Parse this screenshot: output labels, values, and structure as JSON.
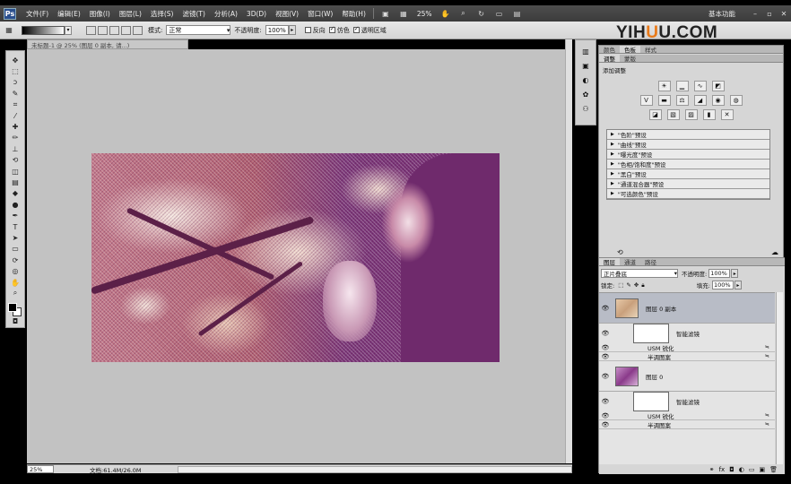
{
  "app": {
    "logo": "Ps"
  },
  "menu": [
    "文件(F)",
    "编辑(E)",
    "图像(I)",
    "图层(L)",
    "选择(S)",
    "滤镜(T)",
    "分析(A)",
    "3D(D)",
    "视图(V)",
    "窗口(W)",
    "帮助(H)"
  ],
  "menubar_right": {
    "zoom": "25%",
    "workspace": "基本功能"
  },
  "options": {
    "mode_label": "模式:",
    "mode_value": "正常",
    "opacity_label": "不透明度:",
    "opacity_value": "100%",
    "reverse_label": "反向",
    "dither_label": "仿色",
    "transparency_label": "透明区域"
  },
  "watermark": {
    "text_a": "YIH",
    "text_u": "U",
    "text_b": "U.COM"
  },
  "document": {
    "tab_title": "未标题-1 @ 25% (图层 0 副本, 请...)",
    "zoom": "25%",
    "doc_info": "文档:61.4M/26.0M"
  },
  "adjust_panel": {
    "tabs": [
      "调整",
      "蒙版"
    ],
    "title": "添加调整",
    "presets": [
      "\"色阶\"预设",
      "\"曲线\"预设",
      "\"曝光度\"预设",
      "\"色相/饱和度\"预设",
      "\"黑白\"预设",
      "\"通道混合器\"预设",
      "\"可选颜色\"预设"
    ]
  },
  "top_tabs": [
    "颜色",
    "色板",
    "样式"
  ],
  "layers_panel": {
    "tabs": [
      "图层",
      "通道",
      "路径"
    ],
    "blend_mode": "正片叠底",
    "opacity_label": "不透明度:",
    "opacity_value": "100%",
    "lock_label": "锁定:",
    "fill_label": "填充:",
    "fill_value": "100%",
    "layers": [
      {
        "name": "图层 0 副本",
        "smart_filters_label": "智能滤镜",
        "filters": [
          "USM 锐化",
          "半调图案"
        ]
      },
      {
        "name": "图层 0",
        "smart_filters_label": "智能滤镜",
        "filters": [
          "USM 锐化",
          "半调图案"
        ]
      }
    ]
  }
}
